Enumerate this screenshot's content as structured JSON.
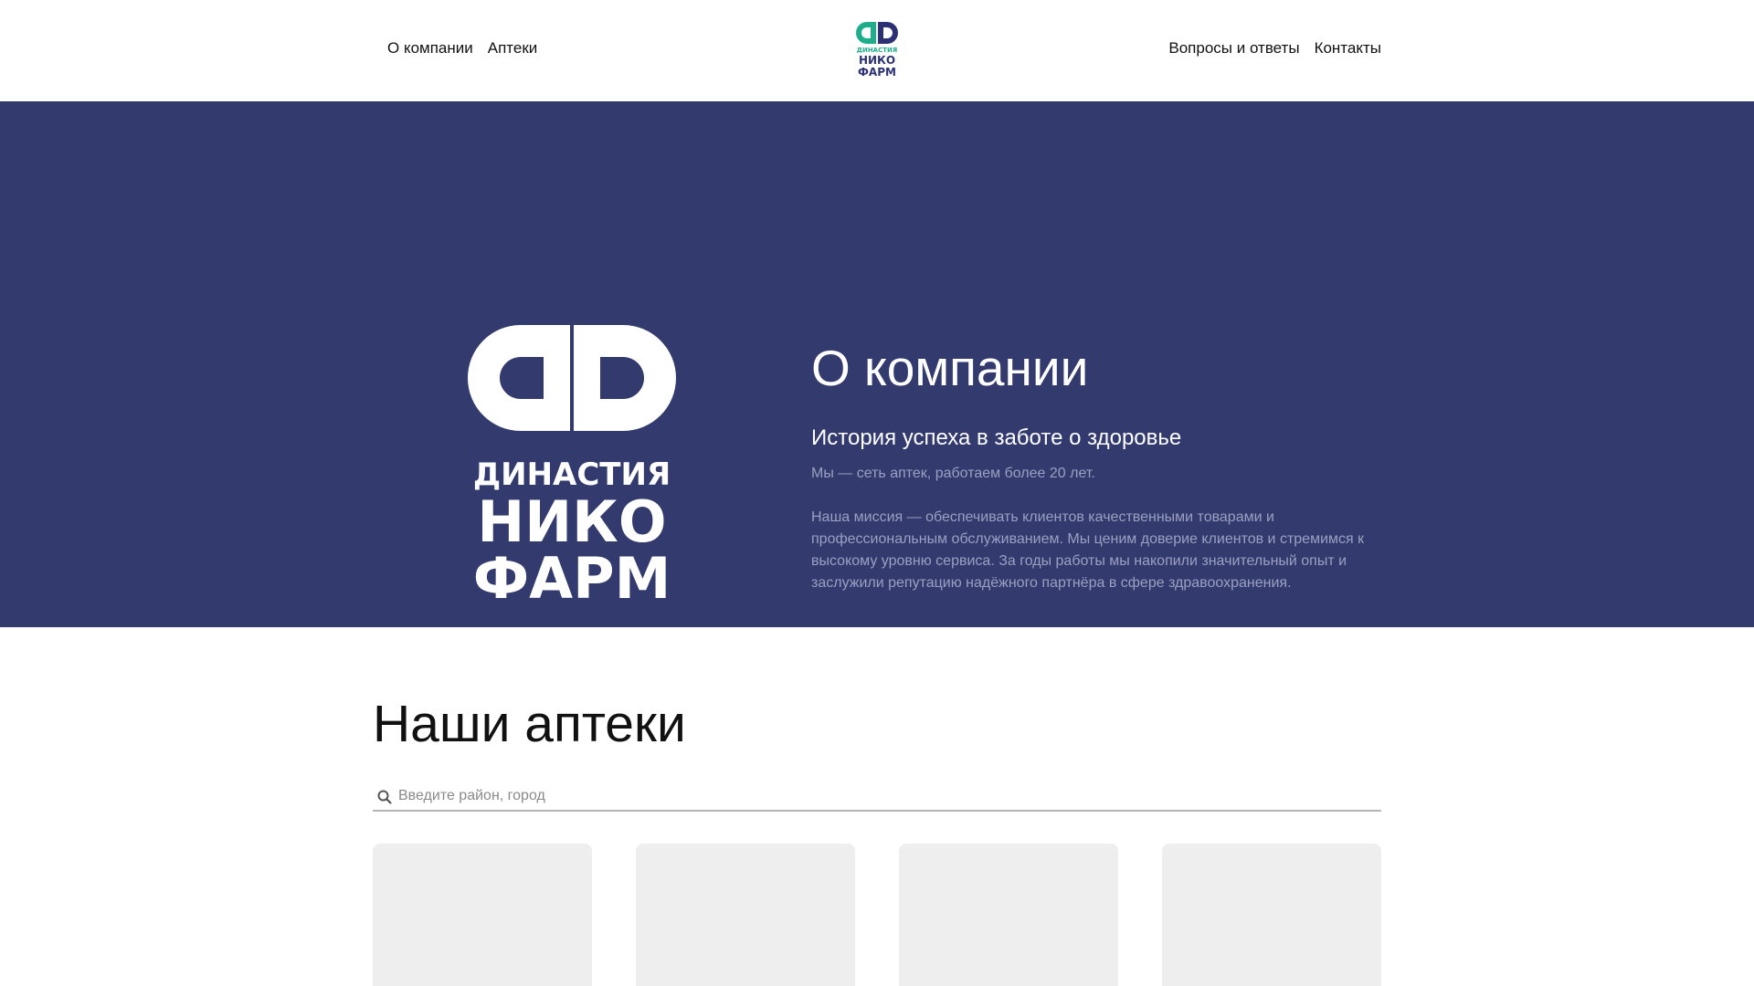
{
  "nav": {
    "left": [
      "О компании",
      "Аптеки"
    ],
    "right": [
      "Вопросы и ответы",
      "Контакты"
    ]
  },
  "logo": {
    "text_line1": "ДИНАСТИЯ",
    "text_line2": "НИКО",
    "text_line3": "ФАРМ",
    "colors": {
      "green": "#1fae8c",
      "navy": "#2b3172",
      "white": "#ffffff"
    }
  },
  "hero": {
    "title": "О компании",
    "subtitle": "История успеха в заботе о здоровье",
    "p1": "Мы — сеть аптек, работаем более 20 лет.",
    "p2": "Наша миссия — обеспечивать клиентов качественными товарами и профессиональным обслуживанием. Мы ценим доверие клиентов и стремимся к высокому уровню сервиса. За годы работы мы накопили значительный опыт и заслужили репутацию надёжного партнёра в сфере здравоохранения.",
    "background": "#323a6e"
  },
  "pharmacies": {
    "title": "Наши аптеки",
    "search": {
      "placeholder": "Введите район, город",
      "value": "",
      "icon": "search-icon"
    }
  }
}
